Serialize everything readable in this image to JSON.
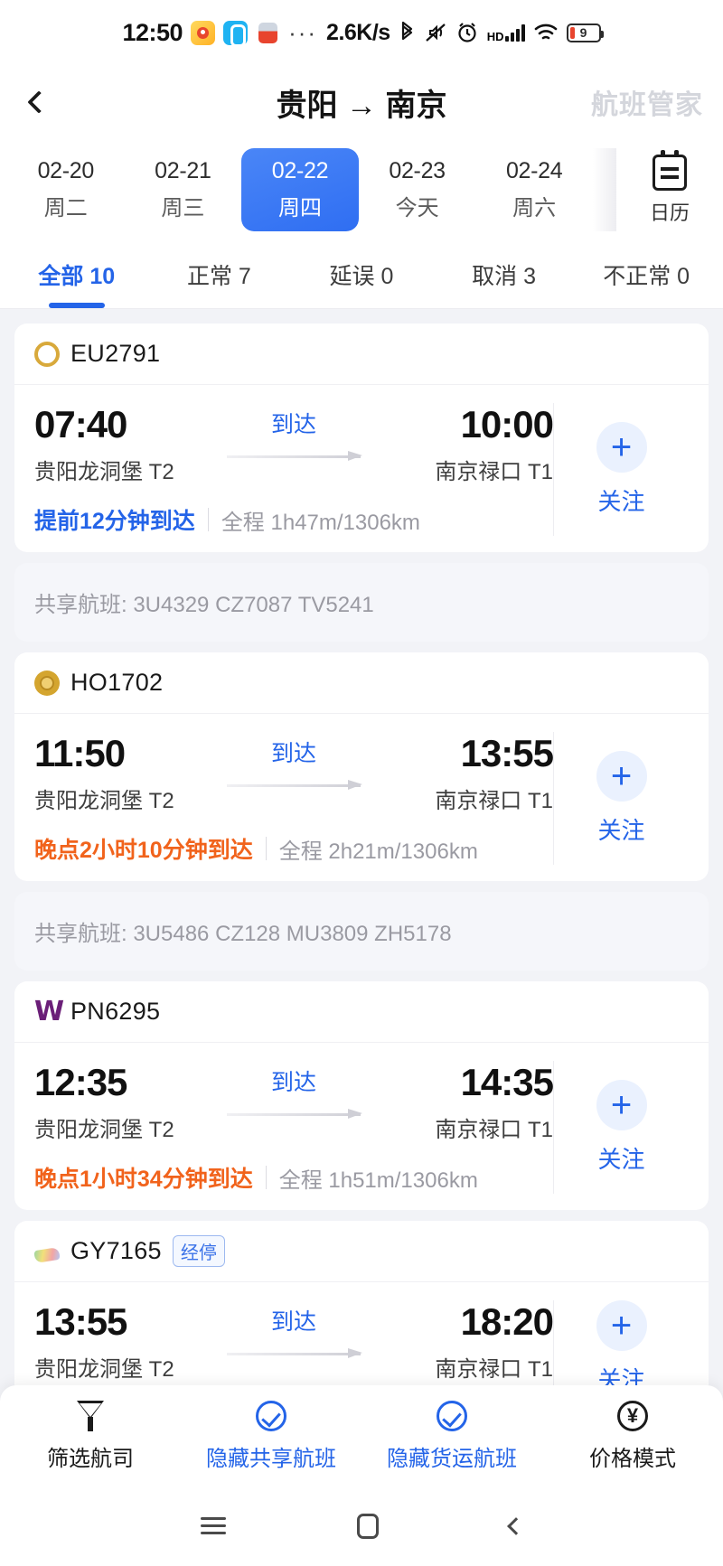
{
  "statusbar": {
    "time": "12:50",
    "icons_left": [
      "weibo-icon",
      "qq-icon",
      "rednote-icon",
      "more-dots-icon"
    ],
    "net_speed": "2.6K/s",
    "icons_right": [
      "bluetooth-icon",
      "mute-icon",
      "alarm-icon",
      "hd-icon",
      "signal-icon",
      "wifi-icon",
      "battery-icon"
    ],
    "hd_label": "HD",
    "battery_level": "9"
  },
  "navbar": {
    "title": "贵阳 → 南京",
    "brand": "航班管家",
    "back_icon": "chevron-left-icon"
  },
  "datestrip": {
    "dates": [
      {
        "date": "02-20",
        "day": "周二",
        "selected": false
      },
      {
        "date": "02-21",
        "day": "周三",
        "selected": false
      },
      {
        "date": "02-22",
        "day": "周四",
        "selected": true
      },
      {
        "date": "02-23",
        "day": "今天",
        "selected": false
      },
      {
        "date": "02-24",
        "day": "周六",
        "selected": false
      }
    ],
    "calendar_label": "日历",
    "calendar_icon": "calendar-icon"
  },
  "tabs": [
    {
      "label": "全部 10",
      "active": true
    },
    {
      "label": "正常 7",
      "active": false
    },
    {
      "label": "延误 0",
      "active": false
    },
    {
      "label": "取消 3",
      "active": false
    },
    {
      "label": "不正常 0",
      "active": false
    }
  ],
  "labels": {
    "arrive": "到达",
    "follow": "关注",
    "plus_icon": "plus-icon",
    "codeshare_prefix": "共享航班:",
    "distance_prefix": "全程"
  },
  "flights": [
    {
      "flight_no": "EU2791",
      "logo": "eu",
      "badge": "",
      "dep_time": "07:40",
      "dep_airport": "贵阳龙洞堡 T2",
      "arr_time": "10:00",
      "arr_airport": "南京禄口 T1",
      "mid_label": "到达",
      "status": "提前12分钟到达",
      "status_type": "early",
      "distance": "全程 1h47m/1306km",
      "codeshare": "共享航班: 3U4329 CZ7087 TV5241"
    },
    {
      "flight_no": "HO1702",
      "logo": "ho",
      "badge": "",
      "dep_time": "11:50",
      "dep_airport": "贵阳龙洞堡 T2",
      "arr_time": "13:55",
      "arr_airport": "南京禄口 T1",
      "mid_label": "到达",
      "status": "晚点2小时10分钟到达",
      "status_type": "late",
      "distance": "全程 2h21m/1306km",
      "codeshare": "共享航班: 3U5486 CZ128 MU3809 ZH5178"
    },
    {
      "flight_no": "PN6295",
      "logo": "pn",
      "badge": "",
      "dep_time": "12:35",
      "dep_airport": "贵阳龙洞堡 T2",
      "arr_time": "14:35",
      "arr_airport": "南京禄口 T1",
      "mid_label": "到达",
      "status": "晚点1小时34分钟到达",
      "status_type": "late",
      "distance": "全程 1h51m/1306km",
      "codeshare": ""
    },
    {
      "flight_no": "GY7165",
      "logo": "gy",
      "badge": "经停",
      "dep_time": "13:55",
      "dep_airport": "贵阳龙洞堡 T2",
      "arr_time": "18:20",
      "arr_airport": "南京禄口 T1",
      "mid_label": "到达",
      "status": "",
      "status_type": "",
      "distance": "",
      "codeshare": ""
    }
  ],
  "bottombar": [
    {
      "label": "筛选航司",
      "icon": "funnel-icon",
      "active": false
    },
    {
      "label": "隐藏共享航班",
      "icon": "check-circle-icon",
      "active": true
    },
    {
      "label": "隐藏货运航班",
      "icon": "check-circle-icon",
      "active": true
    },
    {
      "label": "价格模式",
      "icon": "yen-circle-icon",
      "active": false
    }
  ],
  "androidnav": [
    {
      "icon": "recents-icon"
    },
    {
      "icon": "home-icon"
    },
    {
      "icon": "back-icon"
    }
  ]
}
